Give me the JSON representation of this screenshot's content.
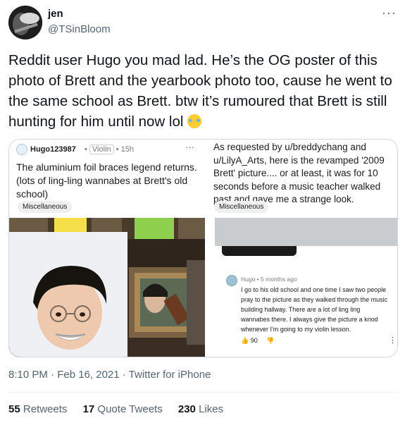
{
  "author": {
    "display_name": "jen",
    "handle": "@TSinBloom",
    "avatar_icon": "profile-photo-avatar"
  },
  "more_icon": "more-horizontal-icon",
  "tweet_text": "Reddit user Hugo you mad lad. He’s the OG poster of this photo of Brett and the yearbook photo too, cause he went to the same school as Brett. btw it’s rumoured that Brett is still hunting for him until now lol",
  "emoji": "face-with-tears-of-joy-emoji",
  "media": {
    "left_post": {
      "username": "Hugo123987",
      "flair": "Violin",
      "time": "15h",
      "title": "The aluminium foil braces legend returns. (lots of ling-ling wannabes at Brett's old school)",
      "category": "Miscellaneous"
    },
    "right_post": {
      "title": "As requested by u/breddychang and u/LilyA_Arts, here is the revamped '2009 Brett' picture.... or at least, it was for 10 seconds before a music teacher walked past and gave me a strange look.",
      "category": "Miscellaneous",
      "comment": {
        "author": "Hugo",
        "time": "5 months ago",
        "text": "I go to his old school and one time I saw two people pray to the picture as they walked through the music building hallway. There are a lot of ling ling wannabes there. I always give the picture a knod whenever I'm going to my violin lesson.",
        "upvotes": "90"
      }
    }
  },
  "timestamp": "8:10 PM · Feb 16, 2021",
  "source": "Twitter for iPhone",
  "stats": {
    "retweets_count": "55",
    "retweets_label": "Retweets",
    "quotes_count": "17",
    "quotes_label": "Quote Tweets",
    "likes_count": "230",
    "likes_label": "Likes"
  },
  "colors": {
    "text": "#0f1419",
    "secondary": "#536471",
    "border": "#cfd9de"
  }
}
